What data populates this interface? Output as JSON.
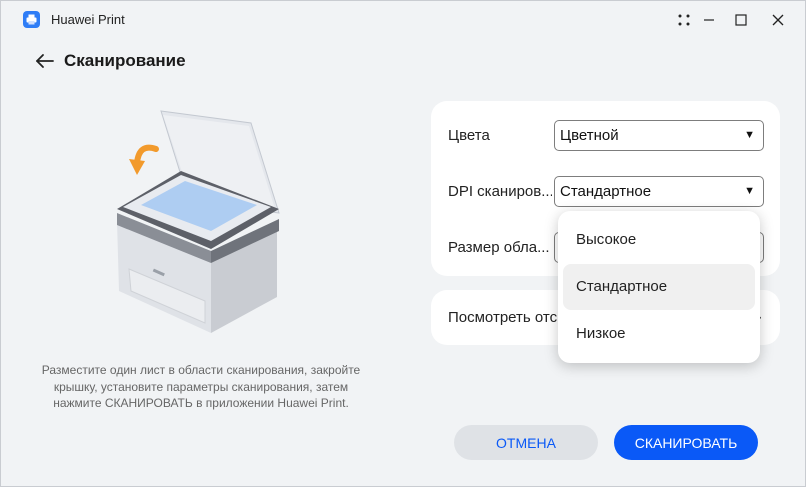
{
  "app": {
    "title": "Huawei Print"
  },
  "window_controls": {
    "icons": [
      "grip-icon",
      "minimize-icon",
      "maximize-icon",
      "close-icon"
    ]
  },
  "header": {
    "title": "Сканирование",
    "back_icon": "arrow-left-icon"
  },
  "illustration": {
    "hint": "Разместите один лист в области сканирования, закройте крышку, установите параметры сканирования, затем нажмите СКАНИРОВАТЬ в приложении Huawei Print."
  },
  "settings": {
    "color": {
      "label": "Цвета",
      "value": "Цветной"
    },
    "dpi": {
      "label": "DPI сканиров...",
      "value": "Стандартное"
    },
    "size": {
      "label": "Размер обла..."
    }
  },
  "preview": {
    "label": "Посмотреть отс"
  },
  "dpi_dropdown": {
    "options": [
      "Высокое",
      "Стандартное",
      "Низкое"
    ],
    "selected": "Стандартное"
  },
  "actions": {
    "cancel": "ОТМЕНА",
    "scan": "СКАНИРОВАТЬ"
  },
  "colors": {
    "accent": "#0a59f7",
    "background": "#f1f3f5",
    "card": "#ffffff"
  }
}
